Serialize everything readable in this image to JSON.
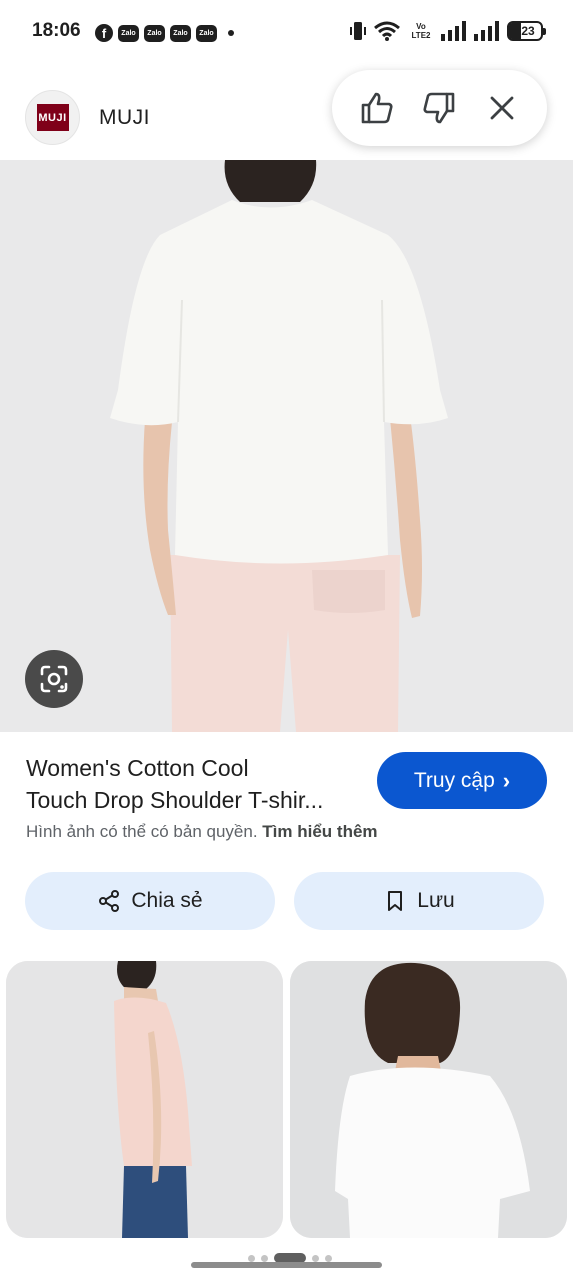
{
  "status_bar": {
    "time": "18:06",
    "battery": "23",
    "network_label_line1": "Vo",
    "network_label_line2": "LTE2",
    "notification_icons": [
      "facebook-icon",
      "zalo-icon",
      "zalo-icon",
      "zalo-icon",
      "zalo-icon"
    ],
    "zalo_label": "Zalo",
    "facebook_label": "f"
  },
  "header": {
    "brand_logo_text": "MUJI",
    "brand_name": "MUJI"
  },
  "feedback": {
    "icons": [
      "thumbs-up-icon",
      "thumbs-down-icon",
      "close-icon"
    ]
  },
  "product": {
    "title_line1": "Women's Cotton Cool",
    "title_line2": "Touch Drop Shoulder T-shir...",
    "visit_label": "Truy cập",
    "copyright_text": "Hình ảnh có thể có bản quyền.",
    "learn_more": "Tìm hiểu thêm"
  },
  "actions": {
    "share_label": "Chia sẻ",
    "save_label": "Lưu"
  },
  "colors": {
    "accent": "#0b57d0",
    "action_bg": "#e3eefc",
    "brand": "#7f0019"
  }
}
